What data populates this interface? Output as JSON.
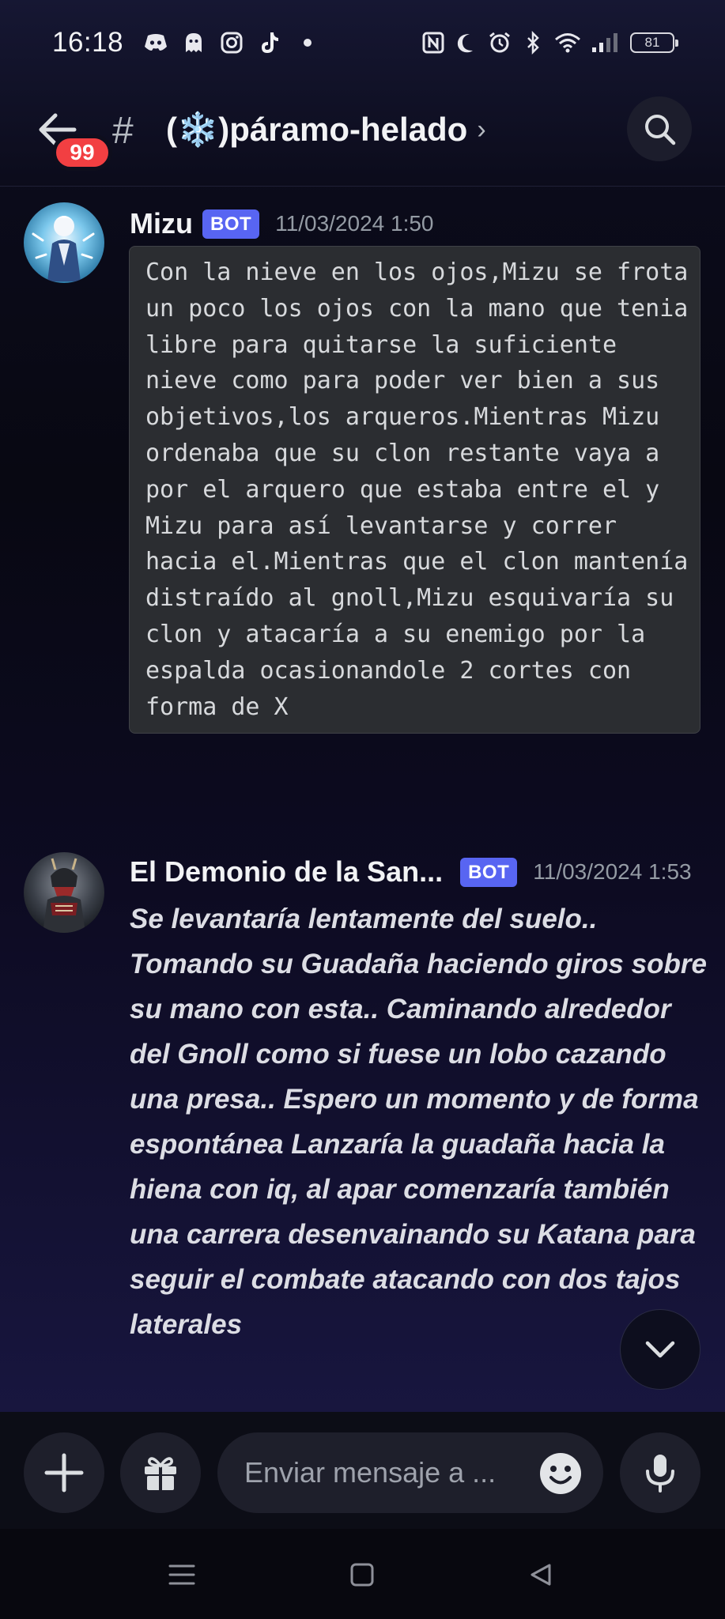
{
  "status_bar": {
    "time": "16:18",
    "left_icons": [
      "discord-icon",
      "ghost-icon",
      "instagram-icon",
      "tiktok-icon",
      "dot-icon"
    ],
    "right_icons": [
      "nfc-icon",
      "moon-icon",
      "alarm-icon",
      "bluetooth-icon",
      "wifi-icon",
      "signal-icon"
    ],
    "battery": "81"
  },
  "header": {
    "badge_count": "99",
    "hash": "#",
    "channel_name": "(❄️)páramo-helado",
    "chevron": "›"
  },
  "messages": [
    {
      "author": "Mizu",
      "bot_tag": "BOT",
      "timestamp": "11/03/2024 1:50",
      "content": "Con la nieve en los ojos,Mizu se frota un poco los ojos con la mano que tenia libre para quitarse la suficiente nieve como para poder ver bien a sus objetivos,los arqueros.Mientras Mizu ordenaba que su clon restante vaya a por el arquero que estaba entre el y Mizu para así levantarse y correr hacia el.Mientras que el clon mantenía distraído al gnoll,Mizu esquivaría su clon y atacaría a su enemigo por la espalda ocasionandole 2 cortes con forma de X"
    },
    {
      "author": "El Demonio de la San...",
      "bot_tag": "BOT",
      "timestamp": "11/03/2024 1:53",
      "content": "Se levantaría lentamente del suelo.. Tomando su Guadaña haciendo giros sobre su mano con esta.. Caminando alrededor del Gnoll como si fuese un lobo cazando una presa.. Espero un momento y de forma espontánea Lanzaría la guadaña hacia la hiena con iq, al apar comenzaría también una carrera desenvainando su Katana para seguir el combate atacando con dos tajos laterales"
    }
  ],
  "composer": {
    "placeholder": "Enviar mensaje a ..."
  },
  "colors": {
    "bot_tag": "#5865f2",
    "badge": "#f23f42",
    "code_bg": "#2b2d31"
  }
}
